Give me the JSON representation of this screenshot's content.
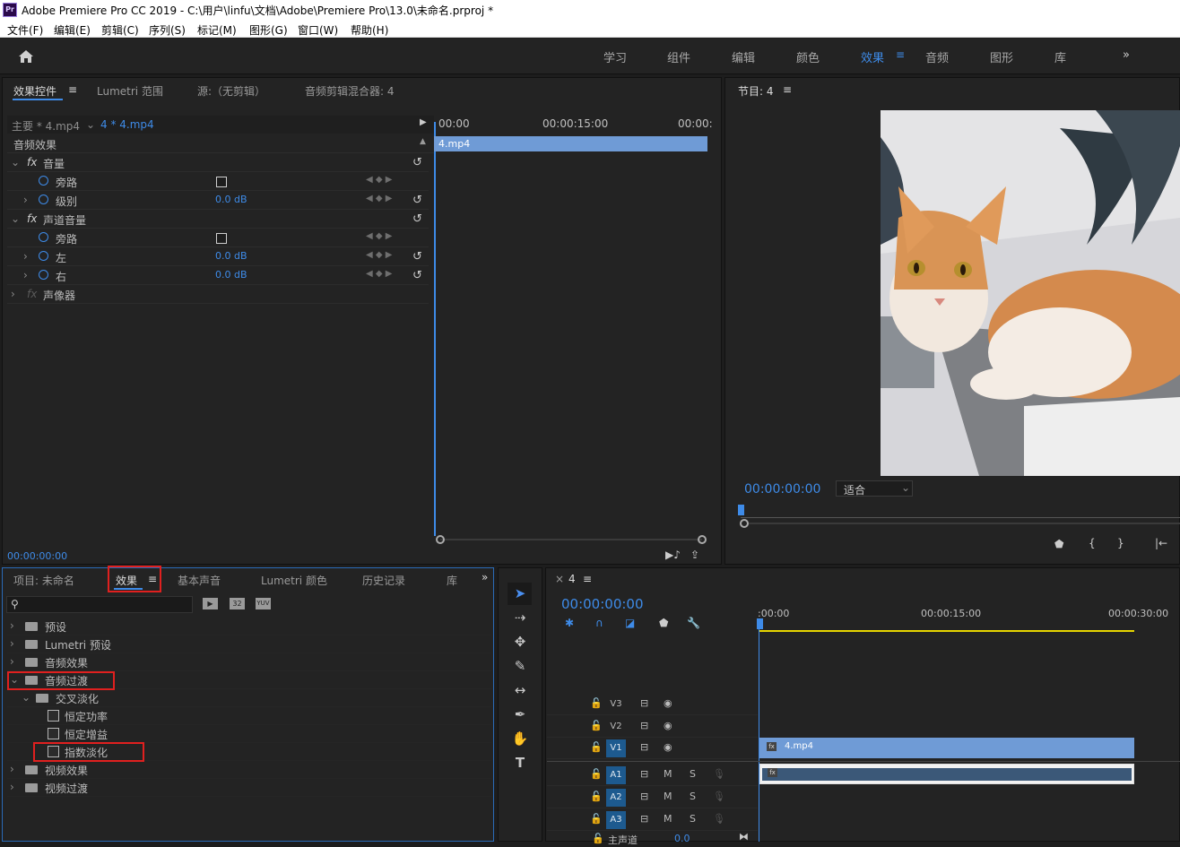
{
  "app": {
    "title": "Adobe Premiere Pro CC 2019 - C:\\用户\\linfu\\文档\\Adobe\\Premiere Pro\\13.0\\未命名.prproj *",
    "logo": "Pr"
  },
  "menu": [
    "文件(F)",
    "编辑(E)",
    "剪辑(C)",
    "序列(S)",
    "标记(M)",
    "图形(G)",
    "窗口(W)",
    "帮助(H)"
  ],
  "workspaces": {
    "items": [
      "学习",
      "组件",
      "编辑",
      "颜色",
      "效果",
      "音频",
      "图形",
      "库"
    ],
    "active": "效果",
    "more": "»"
  },
  "effect_controls": {
    "tabs": [
      "效果控件",
      "Lumetri 范围",
      "源:（无剪辑）",
      "音频剪辑混合器: 4"
    ],
    "master": "主要 * 4.mp4",
    "clip": "4 * 4.mp4",
    "ruler": [
      "00:00",
      "00:00:15:00",
      "00:00:"
    ],
    "clip_bar": "4.mp4",
    "section": "音频效果",
    "rows": {
      "volume": "音量",
      "bypass1": "旁路",
      "level": "级别",
      "level_val": "0.0 dB",
      "channel_volume": "声道音量",
      "bypass2": "旁路",
      "left": "左",
      "left_val": "0.0 dB",
      "right": "右",
      "right_val": "0.0 dB",
      "panner": "声像器"
    },
    "fx": "fx",
    "timecode": "00:00:00:00"
  },
  "program": {
    "title": "节目: 4",
    "timecode": "00:00:00:00",
    "fit": "适合"
  },
  "effects_panel": {
    "tabs": [
      "项目: 未命名",
      "效果",
      "基本声音",
      "Lumetri 颜色",
      "历史记录",
      "库"
    ],
    "badges": [
      "32",
      "YUV"
    ],
    "tree": {
      "presets": "预设",
      "lumetri": "Lumetri 预设",
      "audio_effects": "音频效果",
      "audio_transitions": "音频过渡",
      "crossfade": "交叉淡化",
      "constant_power": "恒定功率",
      "constant_gain": "恒定增益",
      "exponential_fade": "指数淡化",
      "video_effects": "视频效果",
      "video_transitions": "视频过渡"
    }
  },
  "timeline": {
    "seq": "4",
    "timecode": "00:00:00:00",
    "ruler": [
      ":00:00",
      "00:00:15:00",
      "00:00:30:00"
    ],
    "video_tracks": [
      "V3",
      "V2",
      "V1"
    ],
    "audio_tracks": [
      "A1",
      "A2",
      "A3"
    ],
    "m": "M",
    "s": "S",
    "clip": "4.mp4",
    "master": "主声道",
    "master_val": "0.0"
  },
  "colors": {
    "accent": "#3e8be8",
    "highlight": "#e0201f",
    "clip": "#6f9bd6"
  }
}
